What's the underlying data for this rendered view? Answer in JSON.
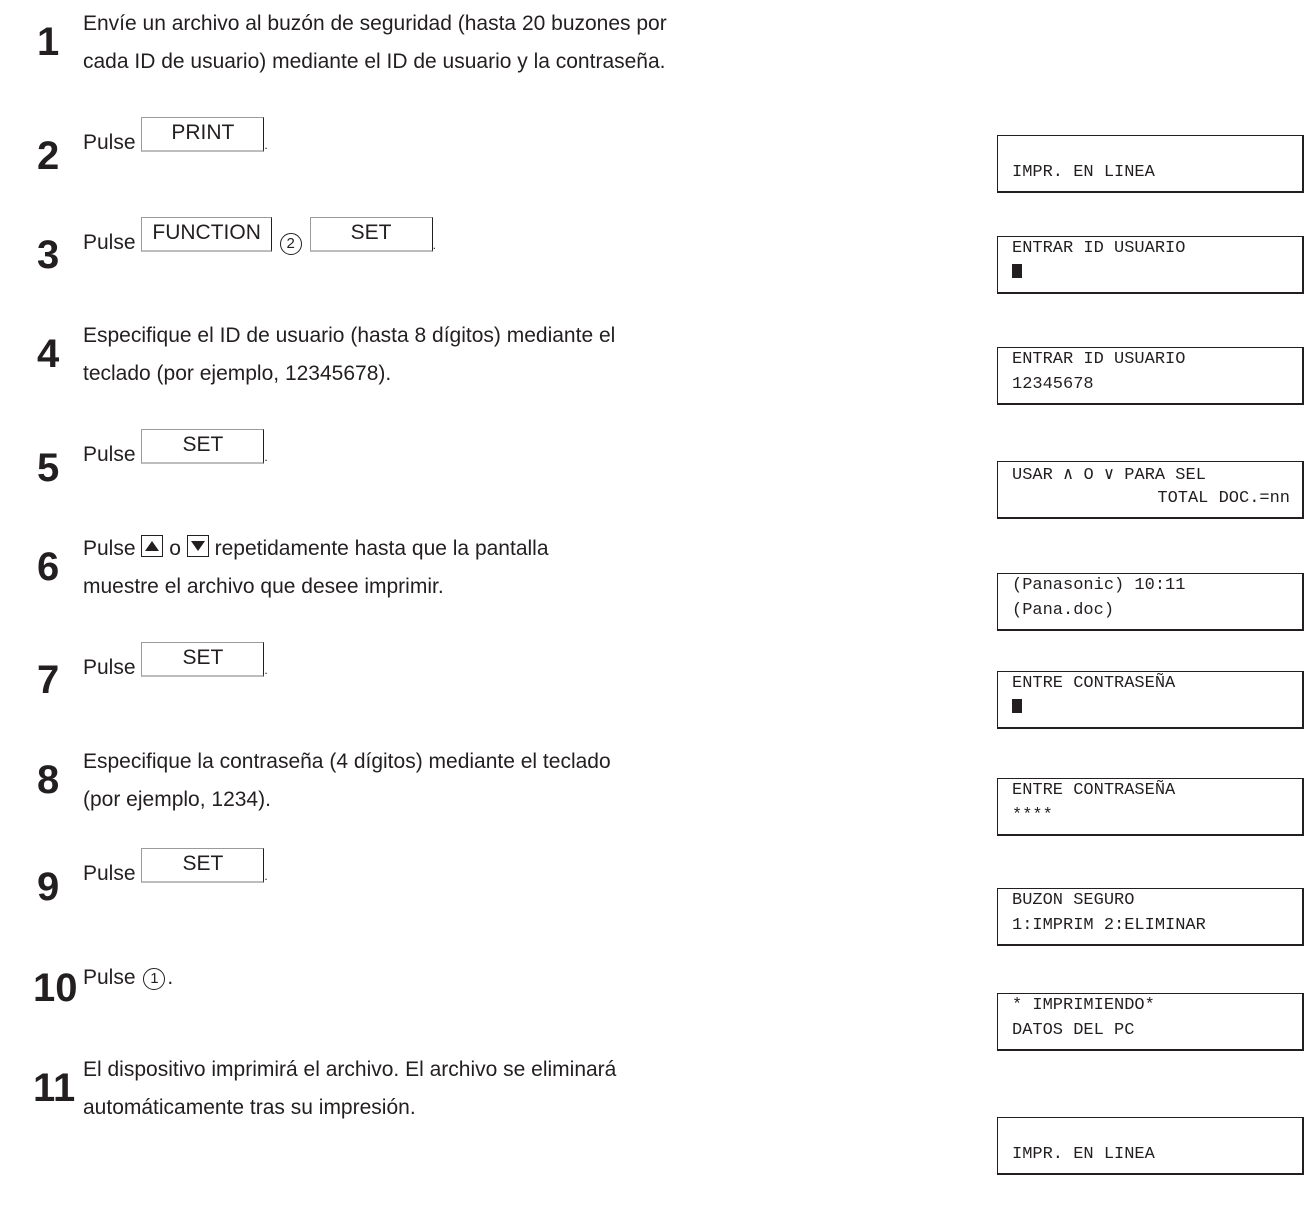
{
  "steps": [
    {
      "num": "1",
      "line1": "Envíe un archivo al buzón de seguridad (hasta 20 buzones por",
      "line2": "cada ID de usuario) mediante el ID de usuario y la contraseña."
    },
    {
      "num": "2",
      "pulse": "Pulse",
      "key": "PRINT"
    },
    {
      "num": "3",
      "pulse": "Pulse",
      "key1": "FUNCTION",
      "circle": "2",
      "key2": "SET"
    },
    {
      "num": "4",
      "line1": "Especifique el ID de usuario (hasta 8 dígitos) mediante el",
      "line2": "teclado (por ejemplo, 12345678)."
    },
    {
      "num": "5",
      "pulse": "Pulse",
      "key": "SET"
    },
    {
      "num": "6",
      "pulse": "Pulse",
      "or": "o",
      "rest": "repetidamente hasta que la pantalla",
      "line2": "muestre el archivo que desee imprimir."
    },
    {
      "num": "7",
      "pulse": "Pulse",
      "key": "SET"
    },
    {
      "num": "8",
      "line1": "Especifique la contraseña (4 dígitos) mediante el teclado",
      "line2": "(por ejemplo, 1234)."
    },
    {
      "num": "9",
      "pulse": "Pulse",
      "key": "SET"
    },
    {
      "num": "10",
      "pulse": "Pulse",
      "circle": "1"
    },
    {
      "num": "11",
      "line1": "El dispositivo imprimirá el archivo. El archivo se eliminará",
      "line2": "automáticamente tras su impresión."
    }
  ],
  "displays": [
    {
      "line1": "",
      "line2": "IMPR. EN LINEA"
    },
    {
      "line1": "ENTRAR ID USUARIO",
      "line2": "",
      "cursor": true
    },
    {
      "line1": "ENTRAR ID USUARIO",
      "line2": "12345678"
    },
    {
      "line1": "USAR ∧ O ∨ PARA SEL",
      "line2": "TOTAL DOC.=nn"
    },
    {
      "line1": "(Panasonic) 10:11",
      "line2": "(Pana.doc)"
    },
    {
      "line1": "ENTRE CONTRASEÑA",
      "line2": "",
      "cursor": true
    },
    {
      "line1": "ENTRE CONTRASEÑA",
      "line2": "****"
    },
    {
      "line1": "BUZON SEGURO",
      "line2": "1:IMPRIM 2:ELIMINAR"
    },
    {
      "line1": "* IMPRIMIENDO*",
      "line2": "DATOS DEL PC"
    },
    {
      "line1": "",
      "line2": "IMPR. EN LINEA"
    }
  ],
  "icons": {
    "up": "up-arrow-key-icon",
    "down": "down-arrow-key-icon"
  }
}
